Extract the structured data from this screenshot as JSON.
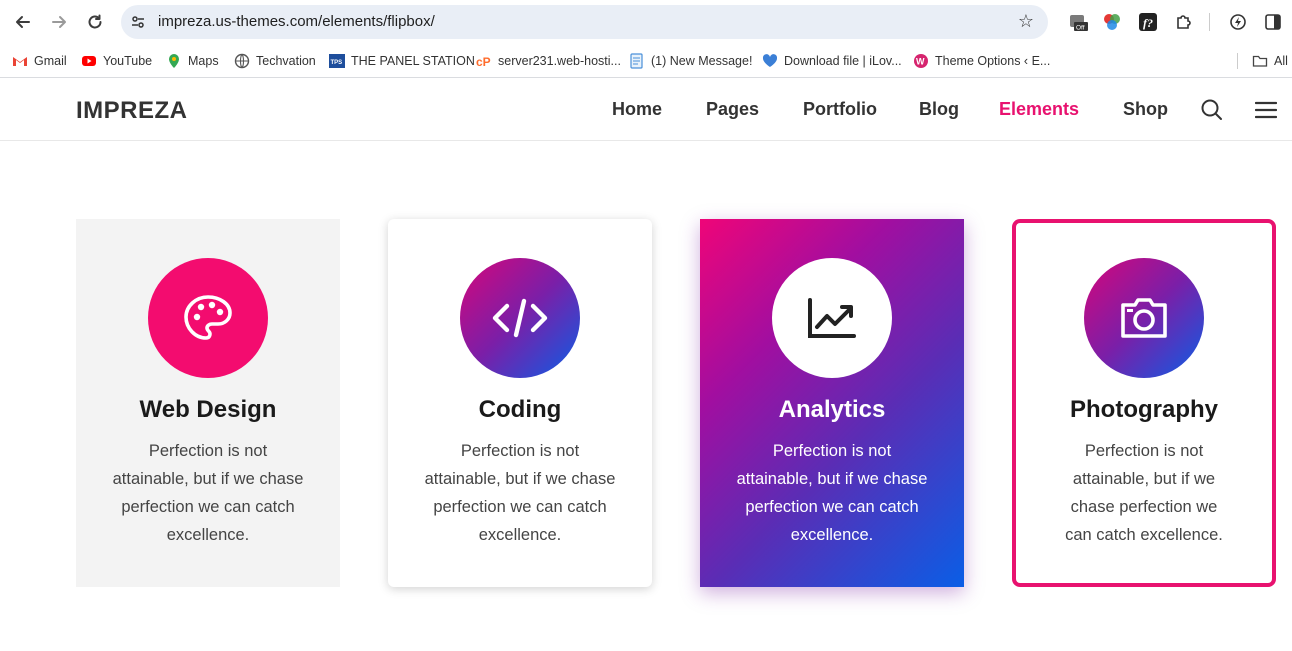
{
  "browser": {
    "url": "impreza.us-themes.com/elements/flipbox/",
    "bookmarks": [
      {
        "label": "Gmail",
        "color": "#ea4335"
      },
      {
        "label": "YouTube",
        "color": "#ff0000"
      },
      {
        "label": "Maps",
        "color": "#34a853"
      },
      {
        "label": "Techvation",
        "color": "#555555"
      },
      {
        "label": "THE PANEL STATION",
        "color": "#1e4e9c"
      },
      {
        "label": "server231.web-hosti...",
        "color": "#ff6c2c"
      },
      {
        "label": "(1) New Message!",
        "color": "#4a90d9"
      },
      {
        "label": "Download file | iLov...",
        "color": "#3b7fd6"
      },
      {
        "label": "Theme Options ‹ E...",
        "color": "#d6246e"
      },
      {
        "label": "All",
        "color": "#555555"
      }
    ]
  },
  "site": {
    "logo": "IMPREZA",
    "menu": [
      "Home",
      "Pages",
      "Portfolio",
      "Blog",
      "Elements",
      "Shop"
    ],
    "active_color": "#e8126f"
  },
  "cards": [
    {
      "title": "Web Design",
      "icon": "palette-icon",
      "desc": "Perfection is not attainable, but if we chase perfection we can catch excellence."
    },
    {
      "title": "Coding",
      "icon": "code-icon",
      "desc": "Perfection is not attainable, but if we chase perfection we can catch excellence."
    },
    {
      "title": "Analytics",
      "icon": "chart-line-icon",
      "desc": "Perfection is not attainable, but if we chase perfection we can catch excellence."
    },
    {
      "title": "Photography",
      "icon": "camera-icon",
      "desc": "Perfection is not attainable, but if we chase perfection we can catch excellence."
    }
  ]
}
